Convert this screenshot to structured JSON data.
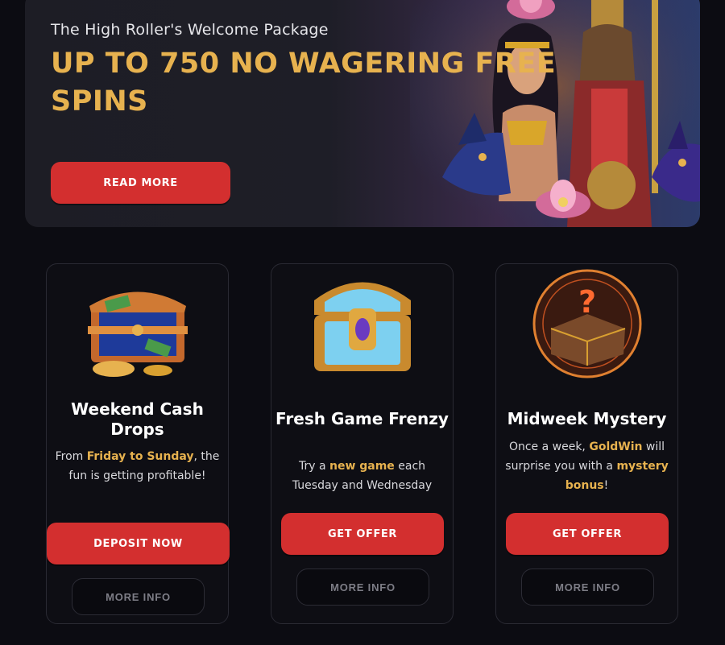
{
  "hero": {
    "subtitle": "The High Roller's Welcome Package",
    "title": "UP TO 750 NO WAGERING FREE SPINS",
    "button_label": "READ MORE"
  },
  "cards": [
    {
      "title": "Weekend Cash Drops",
      "desc_pre": "From ",
      "desc_hl": "Friday to Sunday",
      "desc_post": ", the fun is getting profitable!",
      "primary_label": "DEPOSIT NOW",
      "secondary_label": "MORE INFO",
      "icon": "treasure-chest-icon"
    },
    {
      "title": "Fresh Game Frenzy",
      "desc_pre": "Try a ",
      "desc_hl": "new game",
      "desc_post": " each Tuesday and Wednesday",
      "primary_label": "GET OFFER",
      "secondary_label": "MORE INFO",
      "icon": "chest-icon"
    },
    {
      "title": "Midweek Mystery",
      "desc_pre": "Once a week, ",
      "desc_hl": "GoldWin",
      "desc_mid": " will surprise you with a ",
      "desc_hl2": "mystery bonus",
      "desc_post": "!",
      "primary_label": "GET OFFER",
      "secondary_label": "MORE INFO",
      "icon": "mystery-book-icon"
    }
  ],
  "colors": {
    "accent_gold": "#e7b24f",
    "button_red": "#d32f2f",
    "background": "#0c0c12"
  }
}
